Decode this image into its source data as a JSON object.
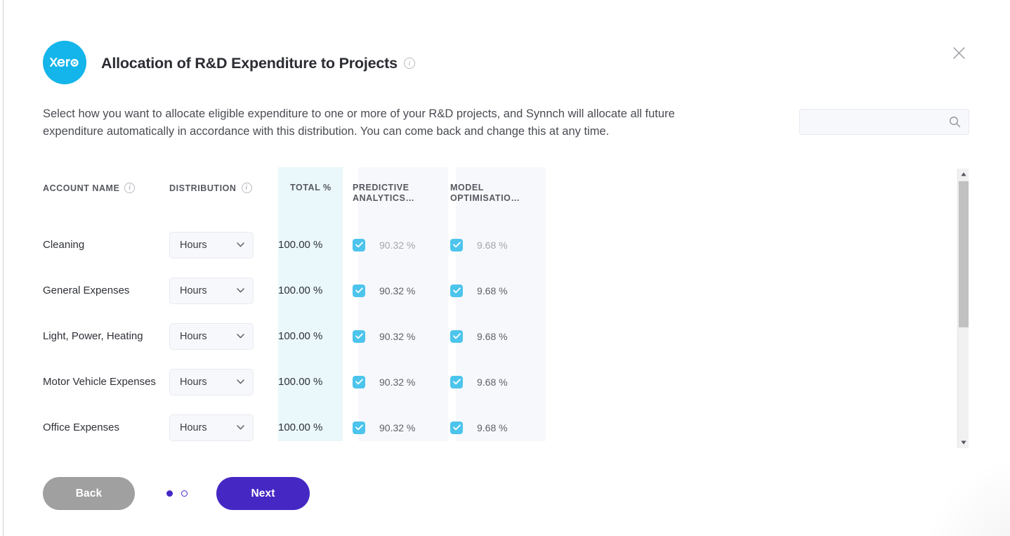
{
  "window": {
    "accent_purple": "#4527c4",
    "accent_cyan": "#13b5ea",
    "checkbox_cyan": "#4cc4ec"
  },
  "header": {
    "logo_name": "xero",
    "logo_text": "xero",
    "title": "Allocation of R&D Expenditure to Projects",
    "title_info_icon": "info-icon",
    "close_icon": "close-icon",
    "close_label": "Close"
  },
  "description": "Select how you want to allocate eligible expenditure to one or more of your R&D projects, and Synnch will allocate all future expenditure automatically in accordance with this distribution. You can come back and change this at any time.",
  "search": {
    "value": "",
    "placeholder": "",
    "icon": "search-icon"
  },
  "table": {
    "headers": {
      "account_name": "ACCOUNT NAME",
      "distribution": "DISTRIBUTION",
      "total_pct": "TOTAL %",
      "projects": [
        "PREDICTIVE ANALYTICS…",
        "MODEL OPTIMISATIO…"
      ]
    },
    "header_info_icons": {
      "account_name": "info-icon",
      "distribution": "info-icon"
    },
    "rows": [
      {
        "account_name": "Cleaning",
        "distribution": "Hours",
        "total_pct": "100.00 %",
        "projects": [
          {
            "checked": true,
            "pct": "90.32 %",
            "muted": true
          },
          {
            "checked": true,
            "pct": "9.68 %",
            "muted": true
          }
        ]
      },
      {
        "account_name": "General Expenses",
        "distribution": "Hours",
        "total_pct": "100.00 %",
        "projects": [
          {
            "checked": true,
            "pct": "90.32 %",
            "muted": false
          },
          {
            "checked": true,
            "pct": "9.68 %",
            "muted": false
          }
        ]
      },
      {
        "account_name": "Light, Power, Heating",
        "distribution": "Hours",
        "total_pct": "100.00 %",
        "projects": [
          {
            "checked": true,
            "pct": "90.32 %",
            "muted": false
          },
          {
            "checked": true,
            "pct": "9.68 %",
            "muted": false
          }
        ]
      },
      {
        "account_name": "Motor Vehicle Expenses",
        "distribution": "Hours",
        "total_pct": "100.00 %",
        "projects": [
          {
            "checked": true,
            "pct": "90.32 %",
            "muted": false
          },
          {
            "checked": true,
            "pct": "9.68 %",
            "muted": false
          }
        ]
      },
      {
        "account_name": "Office Expenses",
        "distribution": "Hours",
        "total_pct": "100.00 %",
        "projects": [
          {
            "checked": true,
            "pct": "90.32 %",
            "muted": false
          },
          {
            "checked": true,
            "pct": "9.68 %",
            "muted": false
          }
        ]
      }
    ],
    "distribution_options": [
      "Hours"
    ]
  },
  "scrollbar": {
    "up_icon": "chevron-up-icon",
    "down_icon": "chevron-down-icon",
    "thumb_name": "scrollbar-thumb"
  },
  "footer": {
    "back_label": "Back",
    "next_label": "Next",
    "dots": [
      {
        "active": true
      },
      {
        "active": false
      }
    ]
  }
}
